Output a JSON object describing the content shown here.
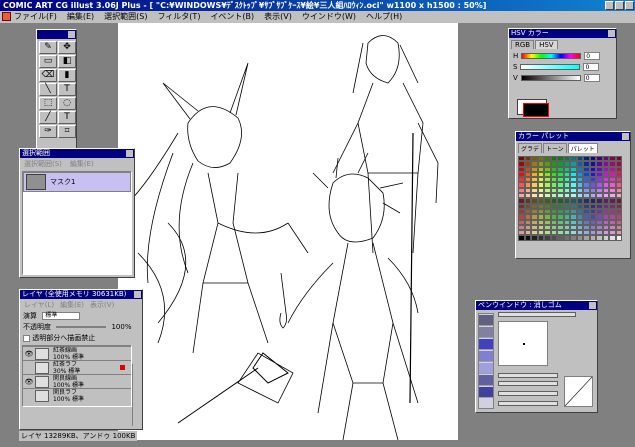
{
  "title": "COMIC ART CG illust 3.06J Plus - [ \"C:¥WINDOWS¥ﾃﾞｽｸﾄｯﾌﾟ¥ｻﾌﾞｻﾌﾞｹｰｽ¥絵¥三人組ﾊﾛｳｨﾝ.oci\"  w1100 x h1500 : 50%]",
  "menu": [
    "ファイル(F)",
    "編集(E)",
    "選択範囲(S)",
    "フィルタ(T)",
    "イベント(B)",
    "表示(V)",
    "ウインドウ(W)",
    "ヘルプ(H)"
  ],
  "tools": [
    {
      "icon": "pen-icon",
      "glyph": "✎"
    },
    {
      "icon": "move-icon",
      "glyph": "✥"
    },
    {
      "icon": "brush-icon",
      "glyph": "▭"
    },
    {
      "icon": "fill-icon",
      "glyph": "◧"
    },
    {
      "icon": "eraser-icon",
      "glyph": "⌫"
    },
    {
      "icon": "gradient-icon",
      "glyph": "▮"
    },
    {
      "icon": "line-icon",
      "glyph": "╲"
    },
    {
      "icon": "text-icon",
      "glyph": "T"
    },
    {
      "icon": "rect-select-icon",
      "glyph": "⬚"
    },
    {
      "icon": "lasso-icon",
      "glyph": "◌"
    },
    {
      "icon": "wand-icon",
      "glyph": "╱"
    },
    {
      "icon": "type-icon",
      "glyph": "T"
    },
    {
      "icon": "dropper-icon",
      "glyph": "✑"
    },
    {
      "icon": "crop-icon",
      "glyph": "⌗"
    }
  ],
  "selection": {
    "title": "選択範囲",
    "menu": [
      "選択範囲(S)",
      "編集(E)"
    ],
    "mask": "マスク1"
  },
  "layers": {
    "title": "レイヤ (全使用メモリ 30631KB)",
    "menu": [
      "レイヤ(L)",
      "編集(E)",
      "表示(V)"
    ],
    "blend_label": "演算",
    "blend_value": "標準",
    "opacity_label": "不透明度",
    "opacity_value": "100%",
    "lock_label": "透明部分へ描画禁止",
    "items": [
      {
        "name": "紅茶線画",
        "info": "100% 標準",
        "eye": "👁",
        "flag": false
      },
      {
        "name": "紅茶ラフ",
        "info": "30% 標準",
        "eye": "",
        "flag": true
      },
      {
        "name": "閑良線画",
        "info": "100% 標準",
        "eye": "👁",
        "flag": false
      },
      {
        "name": "閑良ラフ",
        "info": "100% 標準",
        "eye": "",
        "flag": false
      }
    ]
  },
  "status": "レイヤ 13289KB、アンドゥ 100KB",
  "hsv": {
    "title": "HSV カラー",
    "tabs": [
      "RGB",
      "HSV"
    ],
    "sliders": [
      {
        "label": "H",
        "value": "0"
      },
      {
        "label": "S",
        "value": "0"
      },
      {
        "label": "V",
        "value": "0"
      }
    ],
    "fg_color": "#000000",
    "bg_color": "#ffffff"
  },
  "palette": {
    "title": "カラー パレット",
    "tabs": [
      "グラデ",
      "トーン",
      "パレット"
    ]
  },
  "pen": {
    "title": "ペンウインドウ : 消しゴム"
  }
}
